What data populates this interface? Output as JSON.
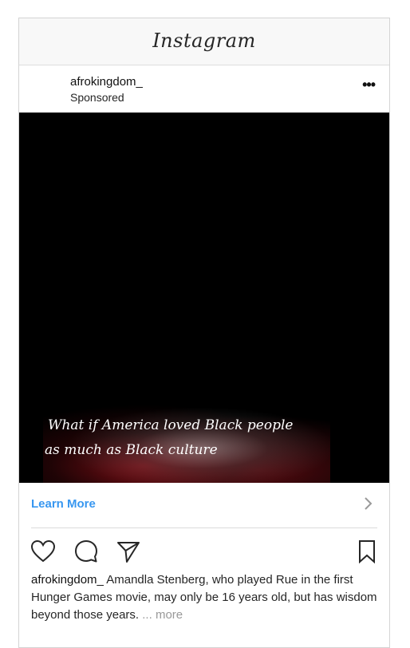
{
  "app": {
    "title": "Instagram"
  },
  "post": {
    "username": "afrokingdom_",
    "sponsored_label": "Sponsored",
    "media": {
      "tagline_line1": "What if America loved Black people",
      "tagline_line2": "as much as Black culture"
    },
    "cta_label": "Learn More",
    "caption": {
      "username": "afrokingdom_",
      "text": "Amandla Stenberg, who played Rue in the first Hunger Games movie, may only be 16 years old, but has wisdom beyond those years.",
      "ellipsis": "...",
      "more_label": "more"
    },
    "icons": {
      "options": "more-options-icon",
      "like": "heart-icon",
      "comment": "comment-icon",
      "share": "share-icon",
      "save": "bookmark-icon",
      "cta": "chevron-right-icon"
    }
  },
  "colors": {
    "link_blue": "#3897f0",
    "text": "#262626",
    "muted": "#999999",
    "media_bg": "#000000"
  }
}
